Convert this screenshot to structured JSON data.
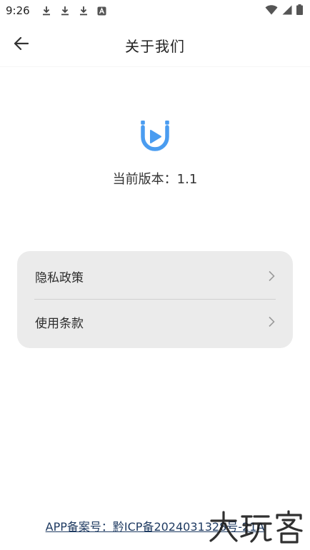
{
  "status_bar": {
    "time": "9:26",
    "icons": [
      "download-icon",
      "download-icon",
      "download-icon",
      "app-notification-icon",
      "wifi-icon",
      "cellular-signal-icon",
      "battery-icon"
    ]
  },
  "header": {
    "title": "关于我们",
    "back_icon": "arrow-left-icon"
  },
  "about": {
    "logo_icon": "app-logo-icon",
    "logo_color": "#4a9cf0",
    "version_text": "当前版本：1.1"
  },
  "menu": {
    "items": [
      {
        "label": "隐私政策",
        "icon": "chevron-right-icon"
      },
      {
        "label": "使用条款",
        "icon": "chevron-right-icon"
      }
    ],
    "background": "#ebebeb"
  },
  "footer": {
    "icp_text": "APP备案号：黔ICP备2024031328号-21A",
    "link_color": "#1f3b62"
  },
  "watermark": {
    "text": "大玩客"
  }
}
